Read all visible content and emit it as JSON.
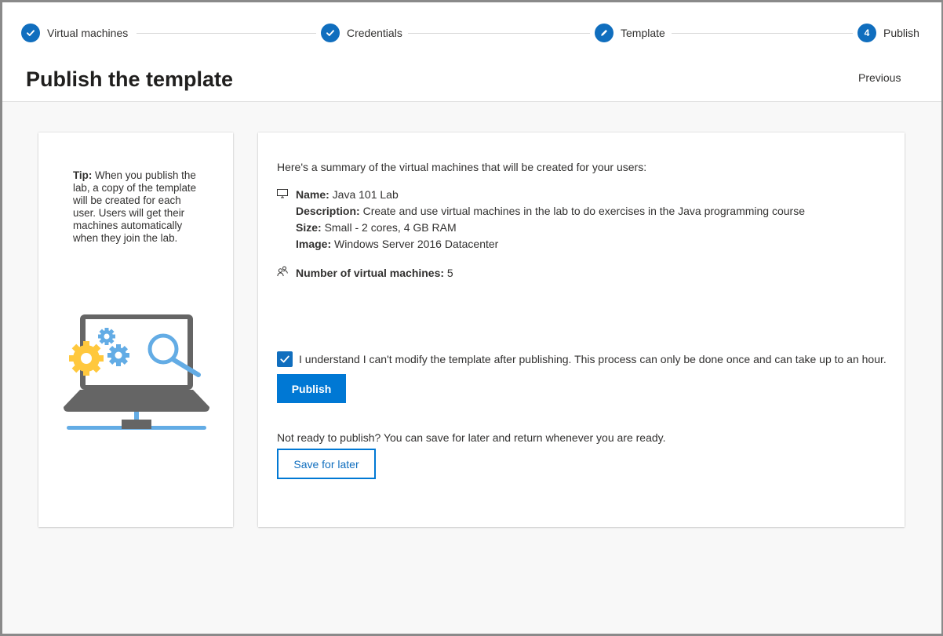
{
  "stepper": {
    "steps": [
      {
        "label": "Virtual machines",
        "state": "completed",
        "icon": "checkmark-icon"
      },
      {
        "label": "Credentials",
        "state": "completed",
        "icon": "checkmark-icon"
      },
      {
        "label": "Template",
        "state": "editing",
        "icon": "pencil-icon"
      },
      {
        "label": "Publish",
        "state": "current",
        "number": "4"
      }
    ]
  },
  "header": {
    "title": "Publish the template",
    "previous_label": "Previous"
  },
  "tip": {
    "label": "Tip:",
    "text": " When you publish the lab, a copy of the template will be created for each user. Users will get their machines automatically when they join the lab."
  },
  "summary": {
    "intro": "Here's a summary of the virtual machines that will be created for your users:",
    "name_label": "Name:",
    "name_value": " Java 101 Lab",
    "description_label": "Description:",
    "description_value": " Create and use virtual machines in the lab to do exercises in the Java programming course",
    "size_label": "Size:",
    "size_value": " Small - 2 cores, 4 GB RAM",
    "image_label": "Image:",
    "image_value": " Windows Server 2016 Datacenter",
    "vm_count_label": "Number of virtual machines:",
    "vm_count_value": " 5"
  },
  "confirm": {
    "checked": true,
    "text": "I understand I can't modify the template after publishing. This process can only be done once and can take up to an hour."
  },
  "actions": {
    "publish_label": "Publish",
    "not_ready_text": "Not ready to publish? You can save for later and return whenever you are ready.",
    "save_later_label": "Save for later"
  },
  "colors": {
    "accent": "#0078d4",
    "step_circle": "#106ebe",
    "gear_yellow": "#ffc83d",
    "light_blue": "#63ace5",
    "laptop_gray": "#656565"
  }
}
